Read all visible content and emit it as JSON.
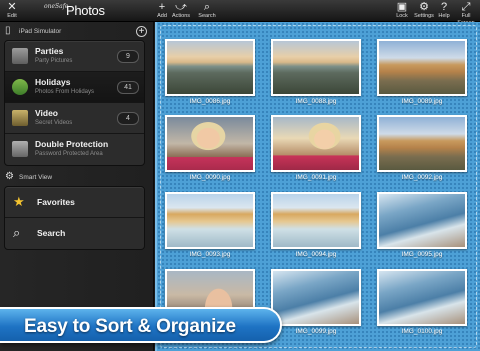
{
  "toolbar": {
    "edit": "Edit",
    "add": "Add",
    "actions": "Actions",
    "search": "Search",
    "lock": "Lock",
    "settings": "Settings",
    "help": "Help",
    "full_screen": "Full Screen"
  },
  "logo": {
    "small": "oneSafe",
    "big": "Photos"
  },
  "sidebar": {
    "device_header": "iPad Simulator",
    "albums": [
      {
        "title": "Parties",
        "subtitle": "Party Pictures",
        "count": "9"
      },
      {
        "title": "Holidays",
        "subtitle": "Photos From Holidays",
        "count": "41"
      },
      {
        "title": "Video",
        "subtitle": "Secret Videos",
        "count": "4"
      },
      {
        "title": "Double Protection",
        "subtitle": "Password Protected Area",
        "count": ""
      }
    ],
    "smart_header": "Smart View",
    "smart_items": [
      {
        "title": "Favorites"
      },
      {
        "title": "Search"
      }
    ]
  },
  "photos": [
    {
      "name": "IMG_0086.jpg"
    },
    {
      "name": "IMG_0088.jpg"
    },
    {
      "name": "IMG_0089.jpg"
    },
    {
      "name": "IMG_0090.jpg"
    },
    {
      "name": "IMG_0091.jpg"
    },
    {
      "name": "IMG_0092.jpg"
    },
    {
      "name": "IMG_0093.jpg"
    },
    {
      "name": "IMG_0094.jpg"
    },
    {
      "name": "IMG_0095.jpg"
    },
    {
      "name": ""
    },
    {
      "name": "IMG_0099.jpg"
    },
    {
      "name": "IMG_0100.jpg"
    }
  ],
  "banner": {
    "text": "Easy to Sort & Organize"
  },
  "colors": {
    "accent_blue": "#1e73c4",
    "background_blue": "#4da0d6",
    "toolbar_dark": "#161616"
  }
}
